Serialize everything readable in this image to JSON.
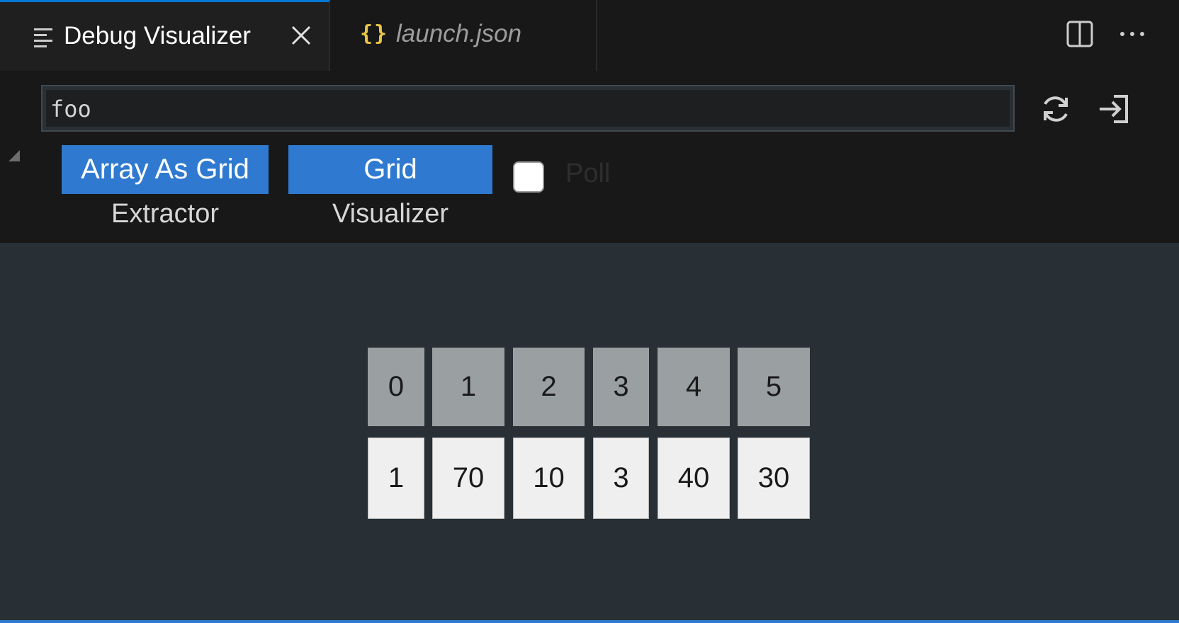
{
  "tabs": [
    {
      "label": "Debug Visualizer",
      "icon": "list-lines-icon",
      "active": true
    },
    {
      "label": "launch.json",
      "icon": "json-braces-icon",
      "active": false
    }
  ],
  "tab_icons": {
    "braces_glyph": "{}",
    "close": "close-icon"
  },
  "actions": [
    "split-editor-icon",
    "more-actions-icon"
  ],
  "expression": {
    "value": "foo"
  },
  "toolbar": [
    "refresh-icon",
    "open-in-editor-icon"
  ],
  "extractor": {
    "selected": "Array As Grid",
    "caption": "Extractor"
  },
  "visualizer": {
    "selected": "Grid",
    "caption": "Visualizer"
  },
  "poll": {
    "label": "Poll",
    "checked": false
  },
  "grid": {
    "indices": [
      "0",
      "1",
      "2",
      "3",
      "4",
      "5"
    ],
    "values": [
      "1",
      "70",
      "10",
      "3",
      "40",
      "30"
    ]
  },
  "colors": {
    "accent": "#2f7ad0",
    "index_cell": "#9a9fa2",
    "value_cell": "#efefef",
    "viz_bg": "#282f35"
  }
}
